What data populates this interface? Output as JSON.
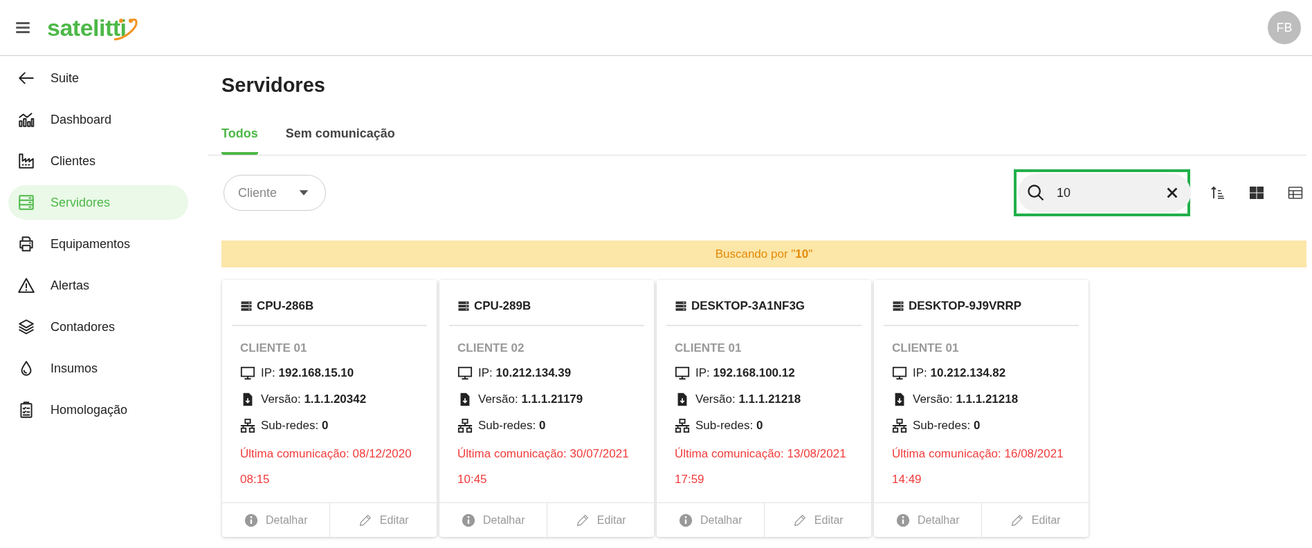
{
  "header": {
    "logo": "satelitti",
    "avatar": "FB"
  },
  "sidebar": {
    "items": [
      {
        "label": "Suite",
        "selected": false
      },
      {
        "label": "Dashboard",
        "selected": false
      },
      {
        "label": "Clientes",
        "selected": false
      },
      {
        "label": "Servidores",
        "selected": true
      },
      {
        "label": "Equipamentos",
        "selected": false
      },
      {
        "label": "Alertas",
        "selected": false
      },
      {
        "label": "Contadores",
        "selected": false
      },
      {
        "label": "Insumos",
        "selected": false
      },
      {
        "label": "Homologação",
        "selected": false
      }
    ]
  },
  "page": {
    "title": "Servidores",
    "tabs": [
      {
        "label": "Todos",
        "selected": true
      },
      {
        "label": "Sem comunicação",
        "selected": false
      }
    ],
    "filter": {
      "label": "Cliente"
    },
    "search": {
      "value": "10"
    },
    "banner": "Buscando por \"**10**\"",
    "cards": [
      {
        "name": "CPU-286B",
        "client": "CLIENTE 01",
        "ip_label": "IP:",
        "ip": "192.168.15.10",
        "version_label": "Versão:",
        "version": "1.1.1.20342",
        "subnets_label": "Sub-redes:",
        "subnets": "0",
        "last_communication": "Última comunicação: 08/12/2020 08:15",
        "actions": [
          "Detalhar",
          "Editar"
        ]
      },
      {
        "name": "CPU-289B",
        "client": "CLIENTE 02",
        "ip_label": "IP:",
        "ip": "10.212.134.39",
        "version_label": "Versão:",
        "version": "1.1.1.21179",
        "subnets_label": "Sub-redes:",
        "subnets": "0",
        "last_communication": "Última comunicação: 30/07/2021 10:45",
        "actions": [
          "Detalhar",
          "Editar"
        ]
      },
      {
        "name": "DESKTOP-3A1NF3G",
        "client": "CLIENTE 01",
        "ip_label": "IP:",
        "ip": "192.168.100.12",
        "version_label": "Versão:",
        "version": "1.1.1.21218",
        "subnets_label": "Sub-redes:",
        "subnets": "0",
        "last_communication": "Última comunicação: 13/08/2021 17:59",
        "actions": [
          "Detalhar",
          "Editar"
        ]
      },
      {
        "name": "DESKTOP-9J9VRRP",
        "client": "CLIENTE 01",
        "ip_label": "IP:",
        "ip": "10.212.134.82",
        "version_label": "Versão:",
        "version": "1.1.1.21218",
        "subnets_label": "Sub-redes:",
        "subnets": "0",
        "last_communication": "Última comunicação: 16/08/2021 14:49",
        "actions": [
          "Detalhar",
          "Editar"
        ]
      }
    ]
  }
}
